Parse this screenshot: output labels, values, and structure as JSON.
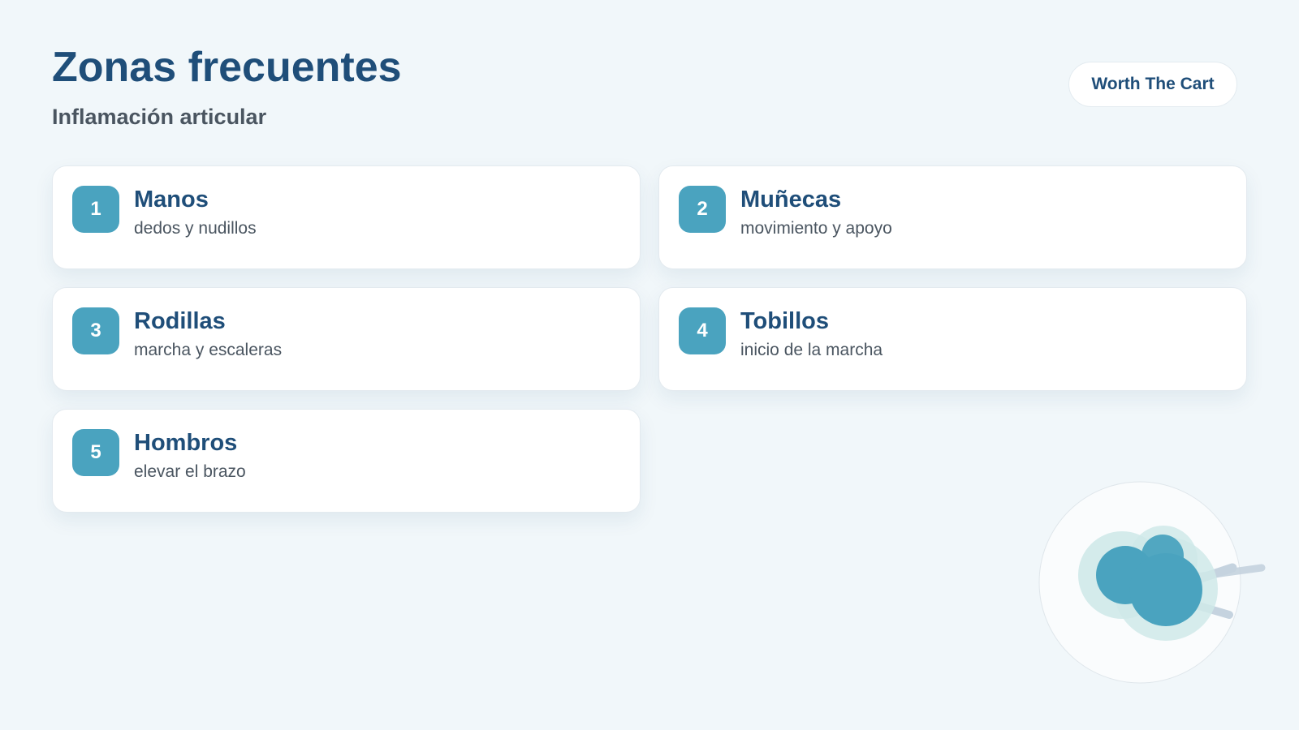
{
  "header": {
    "title": "Zonas frecuentes",
    "subtitle": "Inflamación articular",
    "brand": "Worth The Cart"
  },
  "zones": [
    {
      "number": "1",
      "title": "Manos",
      "description": "dedos y nudillos"
    },
    {
      "number": "2",
      "title": "Muñecas",
      "description": "movimiento y apoyo"
    },
    {
      "number": "3",
      "title": "Rodillas",
      "description": "marcha y escaleras"
    },
    {
      "number": "4",
      "title": "Tobillos",
      "description": "inicio de la marcha"
    },
    {
      "number": "5",
      "title": "Hombros",
      "description": "elevar el brazo"
    }
  ],
  "colors": {
    "background": "#f1f7fa",
    "primary": "#1f4e79",
    "accent": "#4aa3bf",
    "text_muted": "#4a5560"
  },
  "illustration": {
    "icon": "joint-icon"
  }
}
